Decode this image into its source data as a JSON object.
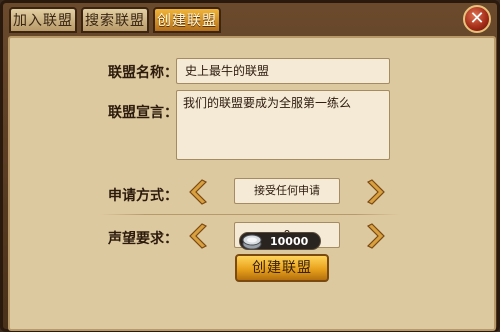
{
  "tabs": [
    {
      "label": "加入联盟",
      "active": false
    },
    {
      "label": "搜索联盟",
      "active": false
    },
    {
      "label": "创建联盟",
      "active": true
    }
  ],
  "close_icon": "close-icon",
  "form": {
    "name_label": "联盟名称：",
    "name_value": "史上最牛的联盟",
    "declaration_label": "联盟宣言：",
    "declaration_value": "我们的联盟要成为全服第一练么",
    "apply_label": "申请方式：",
    "apply_value": "接受任何申请",
    "reputation_label": "声望要求：",
    "reputation_value": "0"
  },
  "cost": {
    "amount": "10000",
    "icon": "silver-coin-icon"
  },
  "create_button_label": "创建联盟",
  "colors": {
    "accent": "#e8a21c",
    "panel": "#ddc9a0",
    "frame": "#4a3119"
  }
}
